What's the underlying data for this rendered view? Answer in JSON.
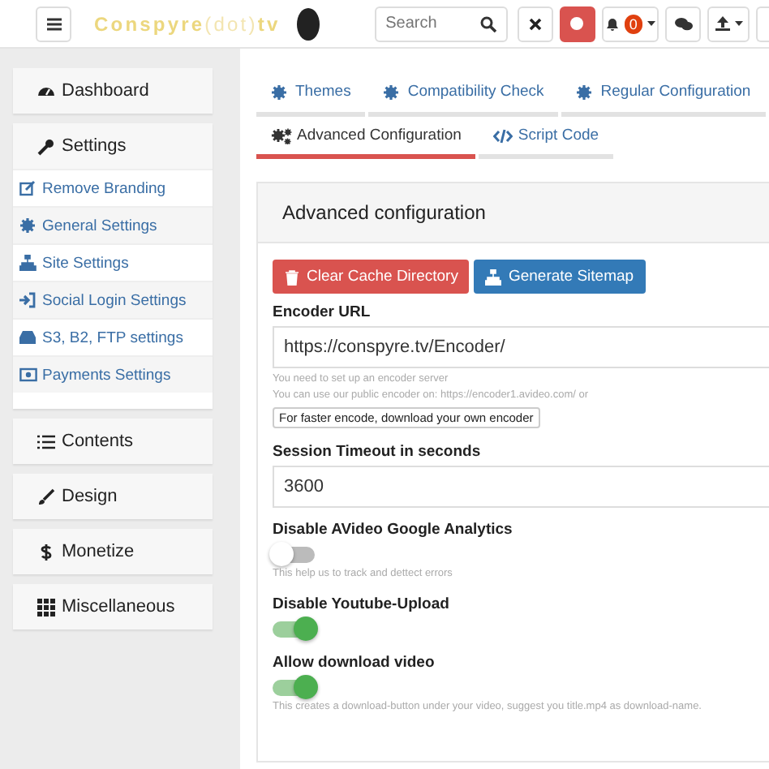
{
  "topbar": {
    "logo": [
      {
        "text": "Conspyre",
        "faded": false
      },
      {
        "text": "(dot)",
        "faded": true
      },
      {
        "text": "tv",
        "faded": false
      }
    ],
    "search": {
      "placeholder": "Search"
    },
    "notifications": {
      "count": "0"
    }
  },
  "sidebar": {
    "groups": [
      {
        "label": "Dashboard"
      },
      {
        "label": "Settings",
        "items": [
          "Remove Branding",
          "General Settings",
          "Site Settings",
          "Social Login Settings",
          "S3, B2, FTP settings",
          "Payments Settings"
        ]
      },
      {
        "label": "Contents"
      },
      {
        "label": "Design"
      },
      {
        "label": "Monetize"
      },
      {
        "label": "Miscellaneous"
      }
    ]
  },
  "tabs": [
    {
      "label": "Themes",
      "selected": false
    },
    {
      "label": "Compatibility Check",
      "selected": false
    },
    {
      "label": "Regular Configuration",
      "selected": false
    },
    {
      "label": "Advanced Configuration",
      "selected": true
    },
    {
      "label": "Script Code",
      "selected": false
    }
  ],
  "panel": {
    "title": "Advanced configuration",
    "actions": [
      {
        "label": "Clear Cache Directory",
        "kind": "danger"
      },
      {
        "label": "Generate Sitemap",
        "kind": "primary"
      }
    ],
    "fields": [
      {
        "kind": "text",
        "label": "Encoder URL",
        "value": "https://conspyre.tv/Encoder/",
        "help": [
          "You need to set up an encoder server",
          "You can use our public encoder on: https://encoder1.avideo.com/ or"
        ],
        "link_button": "For faster encode, download your own encoder"
      },
      {
        "kind": "text",
        "label": "Session Timeout in seconds",
        "value": "3600"
      },
      {
        "kind": "toggle",
        "label": "Disable AVideo Google Analytics",
        "on": false,
        "help": [
          "This help us to track and dettect errors"
        ]
      },
      {
        "kind": "toggle",
        "label": "Disable Youtube-Upload",
        "on": true
      },
      {
        "kind": "toggle",
        "label": "Allow download video",
        "on": true,
        "help": [
          "This creates a download-button under your video, suggest you title.mp4 as download-name."
        ]
      }
    ]
  }
}
